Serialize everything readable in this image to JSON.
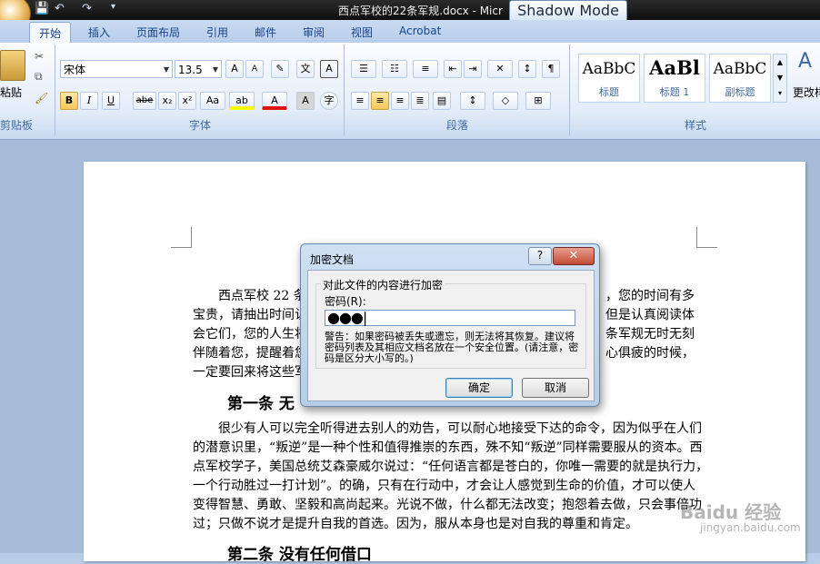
{
  "window": {
    "title": "西点军校的22条军规.docx - Micr",
    "shadow_mode": "Shadow Mode"
  },
  "tabs": [
    "开始",
    "插入",
    "页面布局",
    "引用",
    "邮件",
    "审阅",
    "视图",
    "Acrobat"
  ],
  "ribbon": {
    "clipboard": {
      "paste": "粘贴",
      "label": "剪贴板"
    },
    "font": {
      "name": "宋体",
      "size": "13.5",
      "label": "字体",
      "bold": "B",
      "italic": "I",
      "underline": "U",
      "strike": "abe",
      "sub": "x₂",
      "sup": "x²",
      "case": "Aa"
    },
    "paragraph": {
      "label": "段落"
    },
    "styles": {
      "label": "样式",
      "items": [
        {
          "sample": "AaBbC",
          "name": "标题"
        },
        {
          "sample": "AaBl",
          "name": "标题 1"
        },
        {
          "sample": "AaBbC",
          "name": "副标题"
        }
      ],
      "change": "更改样"
    }
  },
  "document": {
    "para1_lines": [
      "西点军校 22 条",
      "宝贵，请抽出时间认",
      "会它们，您的人生将",
      "伴随着您，提醒着您",
      "一定要回来将这些军"
    ],
    "para1_right": [
      "，您的时间有多",
      "但是认真阅读体",
      "条军规无时无刻",
      "心俱疲的时候，"
    ],
    "heading1": "第一条 无",
    "para2_lines": [
      "很少有人可以完全听得进去别人的劝告，可以耐心地接受下达的命令，因为似乎在人们",
      "的潜意识里，“叛逆”是一种个性和值得推崇的东西，殊不知“叛逆”同样需要服从的资本。西",
      "点军校学子，美国总统艾森豪威尔说过：“任何语言都是苍白的，你唯一需要的就是执行力，",
      "一个行动胜过一打计划”。的确，只有在行动中，才会让人感觉到生命的价值，才可以使人",
      "变得智慧、勇敢、坚毅和高尚起来。光说不做，什么都无法改变；抱怨着去做，只会事倍功",
      "过；只做不说才是提升自我的首选。因为，服从本身也是对自我的尊重和肯定。"
    ],
    "heading2": "第二条 没有任何借口"
  },
  "dialog": {
    "title": "加密文档",
    "help": "?",
    "close": "✕",
    "group": "对此文件的内容进行加密",
    "password_label": "密码(R):",
    "password_value": "●●●|",
    "warning": "警告：如果密码被丢失或遗忘，则无法将其恢复。建议将密码列表及其相应文档名放在一个安全位置。(请注意，密码是区分大小写的。)",
    "ok": "确定",
    "cancel": "取消"
  },
  "watermark": {
    "brand": "Baidu 经验",
    "url": "jingyan.baidu.com"
  }
}
